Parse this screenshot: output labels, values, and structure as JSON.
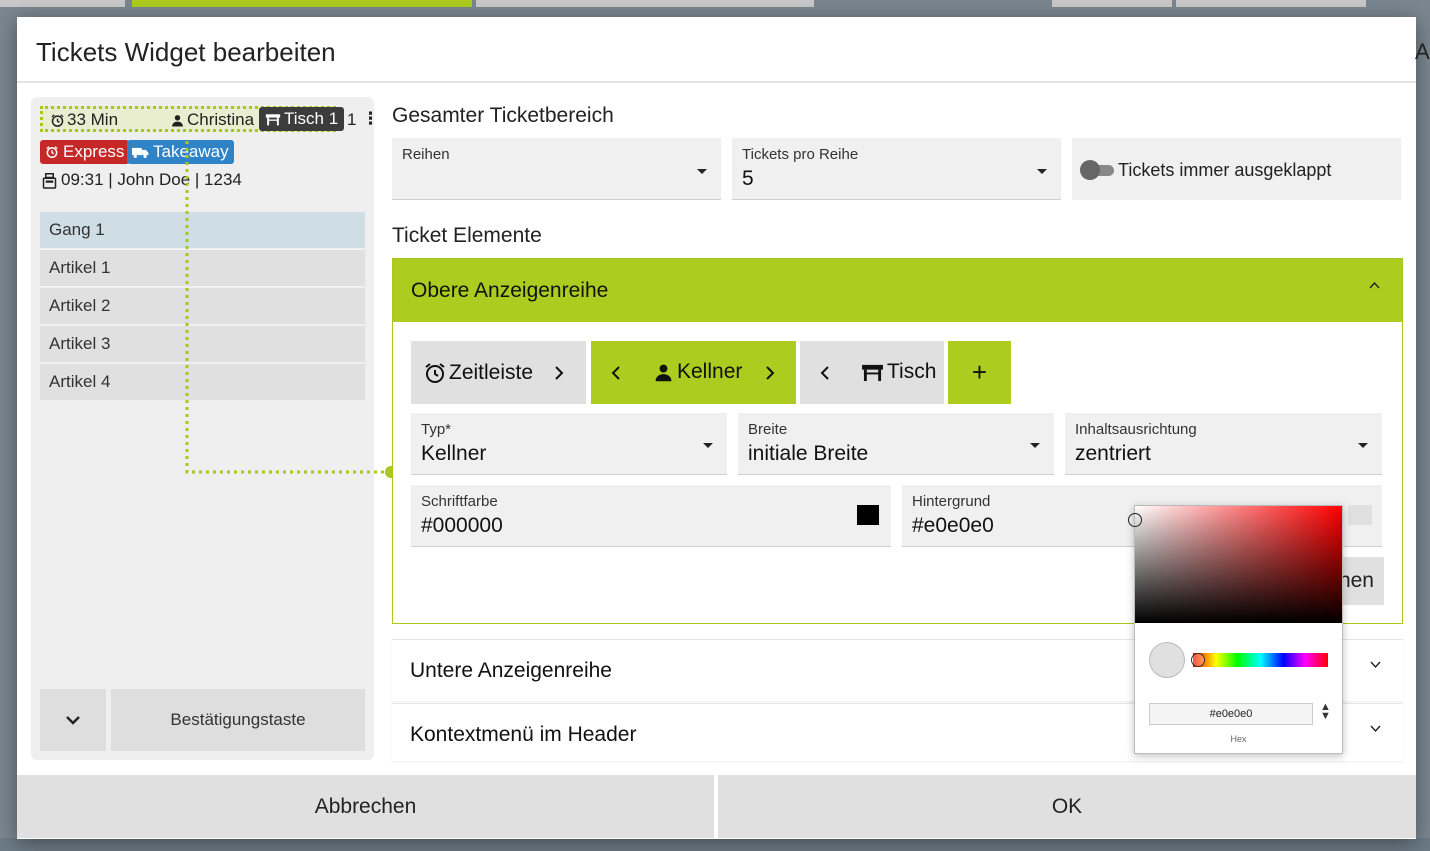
{
  "dialog": {
    "title": "Tickets Widget bearbeiten",
    "peek_text": "Ar"
  },
  "preview": {
    "header": {
      "time": "33 Min",
      "kellner": "Christina",
      "tisch": "Tisch 1",
      "count": "1",
      "more_icon": "more-vert-icon"
    },
    "badges": {
      "express": "Express",
      "takeaway": "Takeaway"
    },
    "info": "09:31 | John Doe | 1234",
    "items": [
      "Gang 1",
      "Artikel 1",
      "Artikel 2",
      "Artikel 3",
      "Artikel 4"
    ],
    "confirm_button": "Bestätigungstaste"
  },
  "gesamter": {
    "title": "Gesamter Ticketbereich",
    "reihen": {
      "label": "Reihen",
      "value": ""
    },
    "tickets_pro_reihe": {
      "label": "Tickets pro Reihe",
      "value": "5"
    },
    "toggle": {
      "label": "Tickets immer ausgeklappt",
      "checked": false
    }
  },
  "elements": {
    "title": "Ticket Elemente",
    "panel_title": "Obere Anzeigenreihe",
    "chips": {
      "zeitleiste": "Zeitleiste",
      "kellner": "Kellner",
      "tisch": "Tisch",
      "add": "+"
    },
    "typ": {
      "label": "Typ*",
      "value": "Kellner"
    },
    "breite": {
      "label": "Breite",
      "value": "initiale Breite"
    },
    "inhalt": {
      "label": "Inhaltsausrichtung",
      "value": "zentriert"
    },
    "schriftfarbe": {
      "label": "Schriftfarbe",
      "value": "#000000",
      "color": "#000000"
    },
    "hintergrund": {
      "label": "Hintergrund",
      "value": "#e0e0e0",
      "color": "#e0e0e0"
    },
    "hidden_button_fragment": "hen"
  },
  "rows": {
    "untere": "Untere Anzeigenreihe",
    "kontext": "Kontextmenü im Header"
  },
  "picker": {
    "hex_value": "#e0e0e0",
    "hex_label": "Hex"
  },
  "footer": {
    "cancel": "Abbrechen",
    "ok": "OK"
  },
  "colors": {
    "accent": "#aecb1f",
    "express": "#c62828",
    "takeaway": "#2f83c7",
    "tisch_badge": "#3c3c3c"
  }
}
